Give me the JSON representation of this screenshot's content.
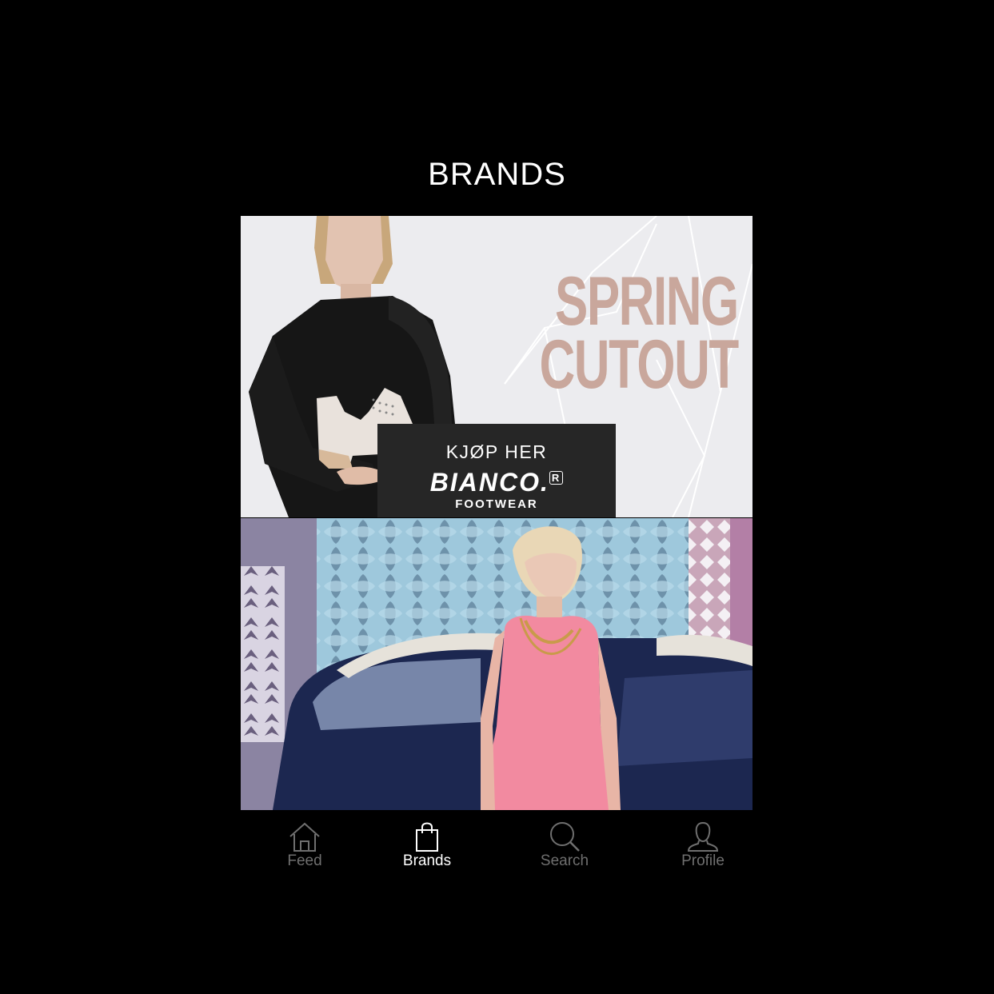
{
  "header": {
    "title": "BRANDS"
  },
  "brand_cards": [
    {
      "promo_lines": [
        "SPRING",
        "CUTOUT"
      ],
      "cta": {
        "label": "KJØP HER",
        "brand": "BIANCO.",
        "registered_mark": "R",
        "sub": "FOOTWEAR"
      }
    },
    {}
  ],
  "tabs": [
    {
      "label": "Feed",
      "icon": "home-icon",
      "active": false
    },
    {
      "label": "Brands",
      "icon": "shopping-bag-icon",
      "active": true
    },
    {
      "label": "Search",
      "icon": "search-icon",
      "active": false
    },
    {
      "label": "Profile",
      "icon": "profile-icon",
      "active": false
    }
  ],
  "colors": {
    "background": "#000000",
    "promo_text": "#c9a79c",
    "cta_background": "#262626",
    "tab_active": "#ffffff",
    "tab_inactive": "#6f6f6f"
  }
}
